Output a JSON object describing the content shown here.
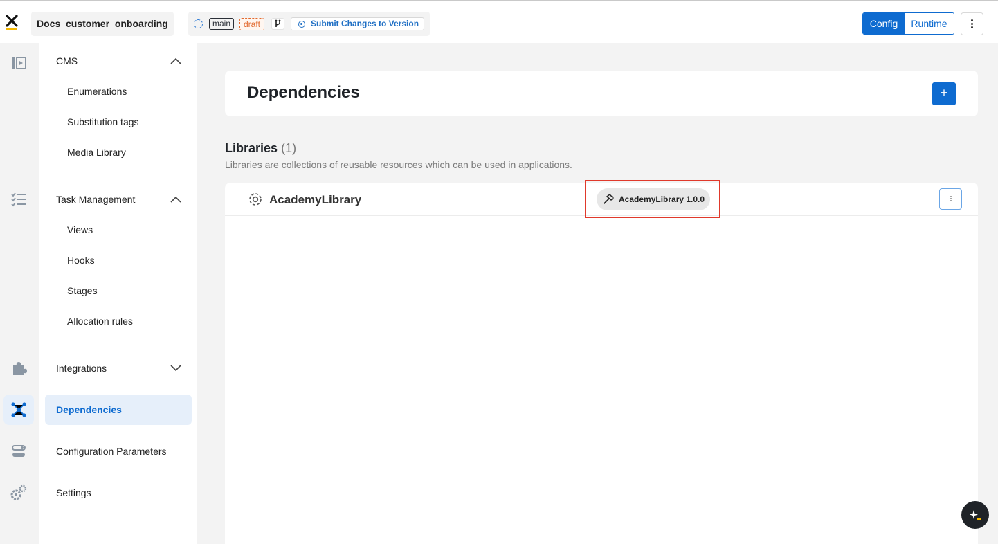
{
  "app": {
    "name": "Docs_customer_onboarding"
  },
  "branch": {
    "name": "main",
    "status": "draft",
    "submit_label": "Submit Changes to Version"
  },
  "mode": {
    "config_label": "Config",
    "runtime_label": "Runtime",
    "selected": "Config"
  },
  "sidebar": {
    "cms": {
      "label": "CMS",
      "items": [
        "Enumerations",
        "Substitution tags",
        "Media Library"
      ]
    },
    "task_management": {
      "label": "Task Management",
      "items": [
        "Views",
        "Hooks",
        "Stages",
        "Allocation rules"
      ]
    },
    "integrations": {
      "label": "Integrations"
    },
    "dependencies": {
      "label": "Dependencies"
    },
    "configuration_parameters": {
      "label": "Configuration Parameters"
    },
    "settings": {
      "label": "Settings"
    }
  },
  "page": {
    "title": "Dependencies",
    "add_label": "+",
    "libraries": {
      "title": "Libraries",
      "count": "(1)",
      "description": "Libraries are collections of reusable resources which can be used in applications.",
      "items": [
        {
          "name": "AcademyLibrary",
          "version": "AcademyLibrary 1.0.0"
        }
      ]
    }
  },
  "colors": {
    "accent": "#0e6bd0",
    "draft": "#e26a2f",
    "highlight": "#e0392b",
    "logo_yellow": "#f5b800"
  },
  "icons": [
    "app-logo-icon",
    "sync-icon",
    "fork-icon",
    "record-icon",
    "kebab-icon",
    "cms-icon",
    "task-list-icon",
    "puzzle-icon",
    "dependencies-icon",
    "config-toggle-icon",
    "settings-gears-icon",
    "gear-icon",
    "hammer-icon",
    "sparkle-icon"
  ]
}
